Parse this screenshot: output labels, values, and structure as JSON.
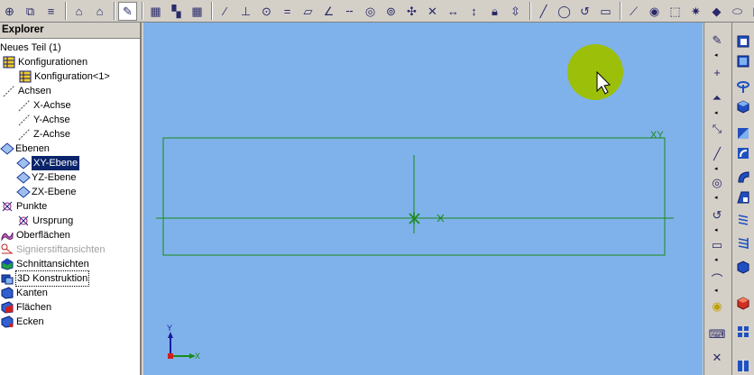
{
  "explorer": {
    "title": "Explorer",
    "items": [
      {
        "label": "Neues Teil (1)",
        "icon": "part-icon"
      },
      {
        "label": "Konfigurationen",
        "icon": "table-icon"
      },
      {
        "label": "Konfiguration<1>",
        "icon": "table-icon"
      },
      {
        "label": "Achsen",
        "icon": "axis-icon"
      },
      {
        "label": "X-Achse",
        "icon": "axis-icon"
      },
      {
        "label": "Y-Achse",
        "icon": "axis-icon"
      },
      {
        "label": "Z-Achse",
        "icon": "axis-icon"
      },
      {
        "label": "Ebenen",
        "icon": "plane-icon"
      },
      {
        "label": "XY-Ebene",
        "icon": "plane-icon"
      },
      {
        "label": "YZ-Ebene",
        "icon": "plane-icon"
      },
      {
        "label": "ZX-Ebene",
        "icon": "plane-icon"
      },
      {
        "label": "Punkte",
        "icon": "point-icon"
      },
      {
        "label": "Ursprung",
        "icon": "point-icon"
      },
      {
        "label": "Oberflächen",
        "icon": "surface-icon"
      },
      {
        "label": "Signierstiftansichten",
        "icon": "markup-icon"
      },
      {
        "label": "Schnittansichten",
        "icon": "section-icon"
      },
      {
        "label": "3D Konstruktion",
        "icon": "construction-icon"
      },
      {
        "label": "Kanten",
        "icon": "edge-icon"
      },
      {
        "label": "Flächen",
        "icon": "face-icon"
      },
      {
        "label": "Ecken",
        "icon": "vertex-icon"
      }
    ]
  },
  "canvas": {
    "plane_label": "XY",
    "axis_y_label": "Y",
    "axis_x_label": "X",
    "background": "#7fb2ea",
    "sketch_color": "#1a8a1a",
    "highlight_color": "#9cbf0a"
  }
}
